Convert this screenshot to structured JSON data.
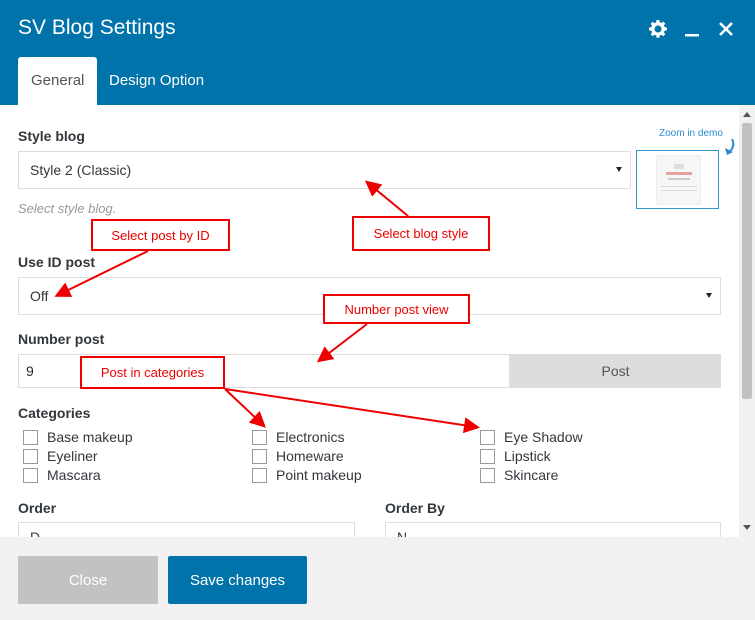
{
  "header": {
    "title": "SV Blog Settings",
    "tabs": [
      {
        "label": "General",
        "active": true
      },
      {
        "label": "Design Option",
        "active": false
      }
    ],
    "icons": [
      "gear-icon",
      "minimize-icon",
      "close-icon"
    ]
  },
  "style_blog": {
    "label": "Style blog",
    "value": "Style 2 (Classic)",
    "hint": "Select style blog.",
    "zoom_label": "Zoom in demo"
  },
  "use_id_post": {
    "label": "Use ID post",
    "value": "Off"
  },
  "number_post": {
    "label": "Number post",
    "value": "9",
    "addon": "Post"
  },
  "categories": {
    "label": "Categories",
    "columns": [
      [
        "Base makeup",
        "Eyeliner",
        "Mascara"
      ],
      [
        "Electronics",
        "Homeware",
        "Point makeup"
      ],
      [
        "Eye Shadow",
        "Lipstick",
        "Skincare"
      ]
    ]
  },
  "order": {
    "label": "Order",
    "value": "D"
  },
  "order_by": {
    "label": "Order By",
    "value": "N"
  },
  "annotations": {
    "select_post_by_id": "Select post by ID",
    "select_blog_style": "Select blog style",
    "number_post_view": "Number post view",
    "post_in_categories": "Post in categories"
  },
  "footer": {
    "close_label": "Close",
    "save_label": "Save changes"
  },
  "colors": {
    "brand": "#0073aa",
    "annotation": "#e00000"
  }
}
